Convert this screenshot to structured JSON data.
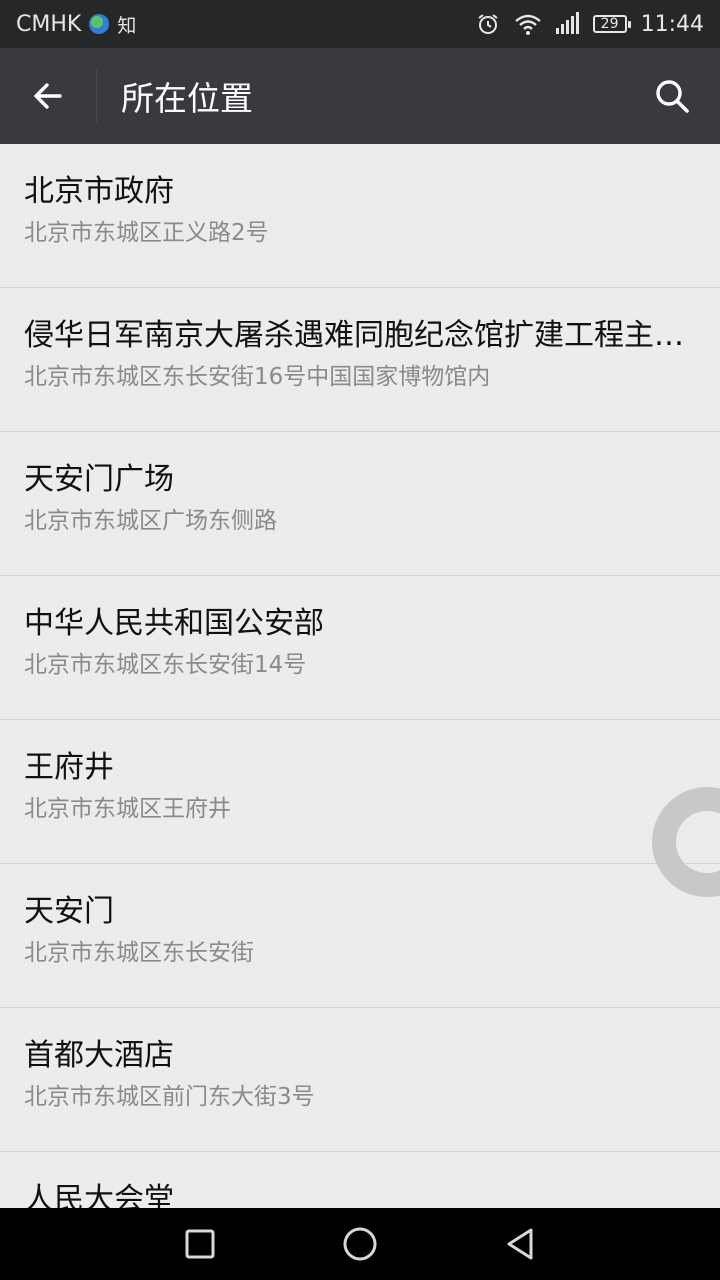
{
  "status_bar": {
    "carrier": "CMHK",
    "app_indicator": "知",
    "battery": "29",
    "time": "11:44",
    "icons": [
      "globe-icon",
      "alarm-icon",
      "wifi-icon",
      "signal-icon",
      "battery-icon"
    ]
  },
  "app_bar": {
    "title": "所在位置",
    "back_icon": "back-arrow-icon",
    "search_icon": "search-icon"
  },
  "locations": [
    {
      "name": "北京市政府",
      "address": "北京市东城区正义路2号"
    },
    {
      "name": "侵华日军南京大屠杀遇难同胞纪念馆扩建工程主…",
      "address": "北京市东城区东长安街16号中国国家博物馆内"
    },
    {
      "name": "天安门广场",
      "address": "北京市东城区广场东侧路"
    },
    {
      "name": "中华人民共和国公安部",
      "address": "北京市东城区东长安街14号"
    },
    {
      "name": "王府井",
      "address": "北京市东城区王府井"
    },
    {
      "name": "天安门",
      "address": "北京市东城区东长安街"
    },
    {
      "name": "首都大酒店",
      "address": "北京市东城区前门东大街3号"
    },
    {
      "name": "人民大会堂",
      "address": ""
    }
  ],
  "nav_bar": {
    "icons": [
      "recents-square-icon",
      "home-circle-icon",
      "back-triangle-icon"
    ]
  },
  "colors": {
    "status_bar": "#262729",
    "app_bar": "#393a3f",
    "list_bg": "#ececec",
    "divider": "#d4d4d4",
    "primary_text": "#111111",
    "secondary_text": "#8a8a8a"
  }
}
